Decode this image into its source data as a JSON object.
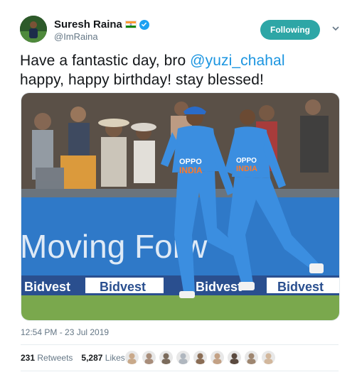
{
  "author": {
    "display_name": "Suresh Raina",
    "handle": "@ImRaina",
    "flag_icon": "india-flag-icon",
    "verified_icon": "verified-badge-icon"
  },
  "follow_button": {
    "label": "Following",
    "color": "#2ea6a6"
  },
  "tweet": {
    "text_part1": "Have a fantastic day, bro ",
    "mention": "@yuzi_chahal",
    "text_part2": "happy, happy birthday! stay blessed!"
  },
  "media": {
    "banner_text": "Moving Forw",
    "board_logos": [
      "Bidvest",
      "Bidvest",
      "Bidvest",
      "Bidvest"
    ],
    "jersey_text": "INDIA",
    "sponsor_text": "OPPO"
  },
  "timestamp": "12:54 PM - 23 Jul 2019",
  "stats": {
    "retweets_count": "231",
    "retweets_label": "Retweets",
    "likes_count": "5,287",
    "likes_label": "Likes"
  },
  "likers": [
    "#c9a98a",
    "#a88d7a",
    "#7b6b5c",
    "#b0b7bf",
    "#8a6d55",
    "#c3a185",
    "#5b4a3f",
    "#9e8670",
    "#d2b79c"
  ],
  "colors": {
    "accent": "#1da1f2",
    "mention": "#1b95e0",
    "muted": "#657786"
  }
}
